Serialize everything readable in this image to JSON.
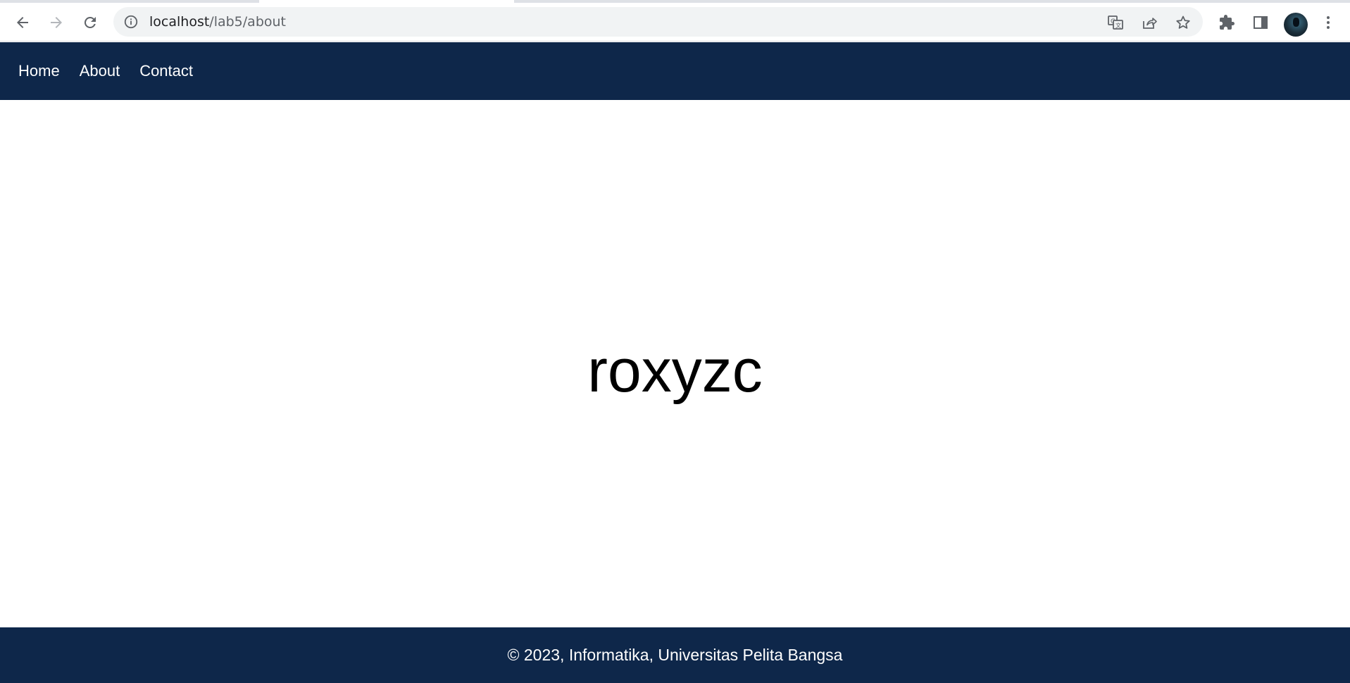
{
  "browser": {
    "url_host": "localhost",
    "url_path": "/lab5/about"
  },
  "nav": {
    "items": [
      {
        "label": "Home"
      },
      {
        "label": "About"
      },
      {
        "label": "Contact"
      }
    ]
  },
  "main": {
    "heading": "roxyzc"
  },
  "footer": {
    "text": "© 2023, Informatika, Universitas Pelita Bangsa"
  },
  "colors": {
    "navbar_bg": "#0e274a",
    "footer_bg": "#0e274a",
    "omnibox_bg": "#f1f3f4"
  },
  "icons": [
    "back-arrow-icon",
    "forward-arrow-icon",
    "reload-icon",
    "site-info-icon",
    "translate-icon",
    "share-icon",
    "bookmark-star-icon",
    "extensions-icon",
    "side-panel-icon",
    "profile-avatar",
    "menu-kebab-icon"
  ]
}
